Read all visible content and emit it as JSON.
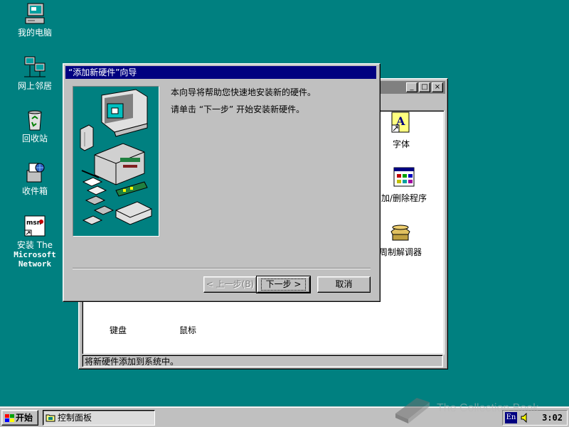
{
  "desktop": {
    "icons": [
      {
        "label": "我的电脑",
        "icon": "my-computer-icon"
      },
      {
        "label": "网上邻居",
        "icon": "network-neighborhood-icon"
      },
      {
        "label": "回收站",
        "icon": "recycle-bin-icon"
      },
      {
        "label": "收件箱",
        "icon": "inbox-icon"
      },
      {
        "label_line1": "安装 The",
        "label_line2": "Microsoft",
        "label_line3": "Network",
        "icon": "msn-icon"
      }
    ]
  },
  "control_panel": {
    "title": "控制面板",
    "status": "将新硬件添加到系统中。",
    "items": [
      {
        "label": "字体",
        "icon": "fonts-icon"
      },
      {
        "label": "添加/删除程序",
        "visible_label": "加/删除程序",
        "icon": "add-remove-programs-icon"
      },
      {
        "label": "调制解调器",
        "visible_label": "周制解调器",
        "icon": "modems-icon"
      },
      {
        "label": "键盘",
        "visible_label": "键盘",
        "icon": "keyboard-icon"
      },
      {
        "label": "鼠标",
        "visible_label": "鼠标",
        "icon": "mouse-icon"
      }
    ]
  },
  "wizard": {
    "title": "“添加新硬件”向导",
    "line1": "本向导将帮助您快速地安装新的硬件。",
    "line2": "请单击 “下一步” 开始安装新硬件。",
    "back_label": "< 上一步(B)",
    "next_label": "下一步 >",
    "cancel_label": "取消"
  },
  "taskbar": {
    "start_label": "开始",
    "task_label": "控制面板",
    "lang_indicator": "En",
    "clock": "3:02"
  },
  "watermark": {
    "text": "The Collection Book"
  },
  "colors": {
    "desktop": "#008080",
    "title_active": "#000080",
    "title_inactive": "#808080",
    "face": "#c0c0c0"
  }
}
